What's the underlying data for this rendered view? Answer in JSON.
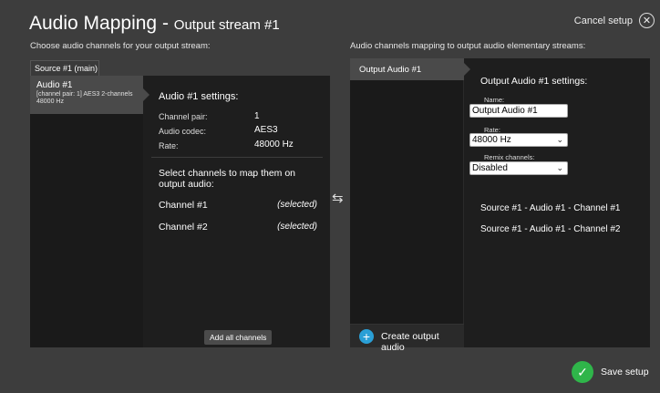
{
  "header": {
    "title": "Audio Mapping",
    "dash": "-",
    "subtitle": "Output stream #1",
    "cancel_label": "Cancel setup",
    "cancel_icon": "✕"
  },
  "left": {
    "caption": "Choose audio channels for your output stream:",
    "source_tab": "Source #1 (main)",
    "audio_item": {
      "title": "Audio #1",
      "detail": "[channel pair: 1] AES3 2-channels 48000 Hz"
    },
    "settings_title": "Audio #1 settings:",
    "settings": [
      {
        "label": "Channel pair:",
        "value": "1"
      },
      {
        "label": "Audio codec:",
        "value": "AES3"
      },
      {
        "label": "Rate:",
        "value": "48000 Hz"
      }
    ],
    "select_prompt": "Select channels to map them on output audio:",
    "channels": [
      {
        "name": "Channel #1",
        "status": "(selected)"
      },
      {
        "name": "Channel #2",
        "status": "(selected)"
      }
    ],
    "add_all_label": "Add all channels"
  },
  "swap_icon": "⇆",
  "right": {
    "caption": "Audio channels mapping to output audio elementary streams:",
    "output_tab": "Output Audio #1",
    "settings_title": "Output Audio #1 settings:",
    "name_label": "Name:",
    "name_value": "Output Audio #1",
    "rate_label": "Rate:",
    "rate_value": "48000 Hz",
    "remix_label": "Remix channels:",
    "remix_value": "Disabled",
    "mappings": [
      "Source #1 - Audio #1 - Channel #1",
      "Source #1 - Audio #1 - Channel #2"
    ],
    "create_label": "Create output audio",
    "create_icon": "+"
  },
  "footer": {
    "save_label": "Save setup",
    "save_icon": "✓"
  },
  "colors": {
    "accent_blue": "#2a9fd6",
    "save_green": "#2fb54a",
    "page_bg": "#3d3d3d",
    "panel_bg": "#1e1e1e"
  }
}
